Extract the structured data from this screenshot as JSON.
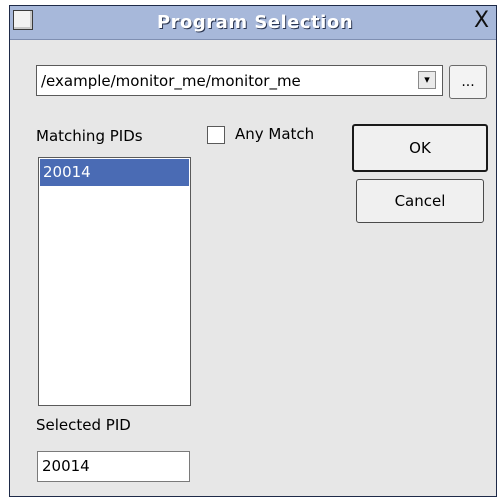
{
  "window": {
    "title": "Program Selection",
    "close_glyph": "X",
    "menu_icon": "window-menu-icon",
    "close_icon": "close-icon"
  },
  "program": {
    "path": "/example/monitor_me/monitor_me",
    "dropdown_glyph": "▾",
    "browse_label": "..."
  },
  "pids": {
    "label": "Matching PIDs",
    "items": [
      "20014"
    ],
    "selected_index": 0
  },
  "any_match": {
    "label": "Any Match",
    "checked": false
  },
  "buttons": {
    "ok": "OK",
    "cancel": "Cancel"
  },
  "selected_pid": {
    "label": "Selected PID",
    "value": "20014"
  },
  "colors": {
    "titlebar": "#a7b8da",
    "selection": "#4a6bb4",
    "dialog_bg": "#e7e7e7"
  }
}
